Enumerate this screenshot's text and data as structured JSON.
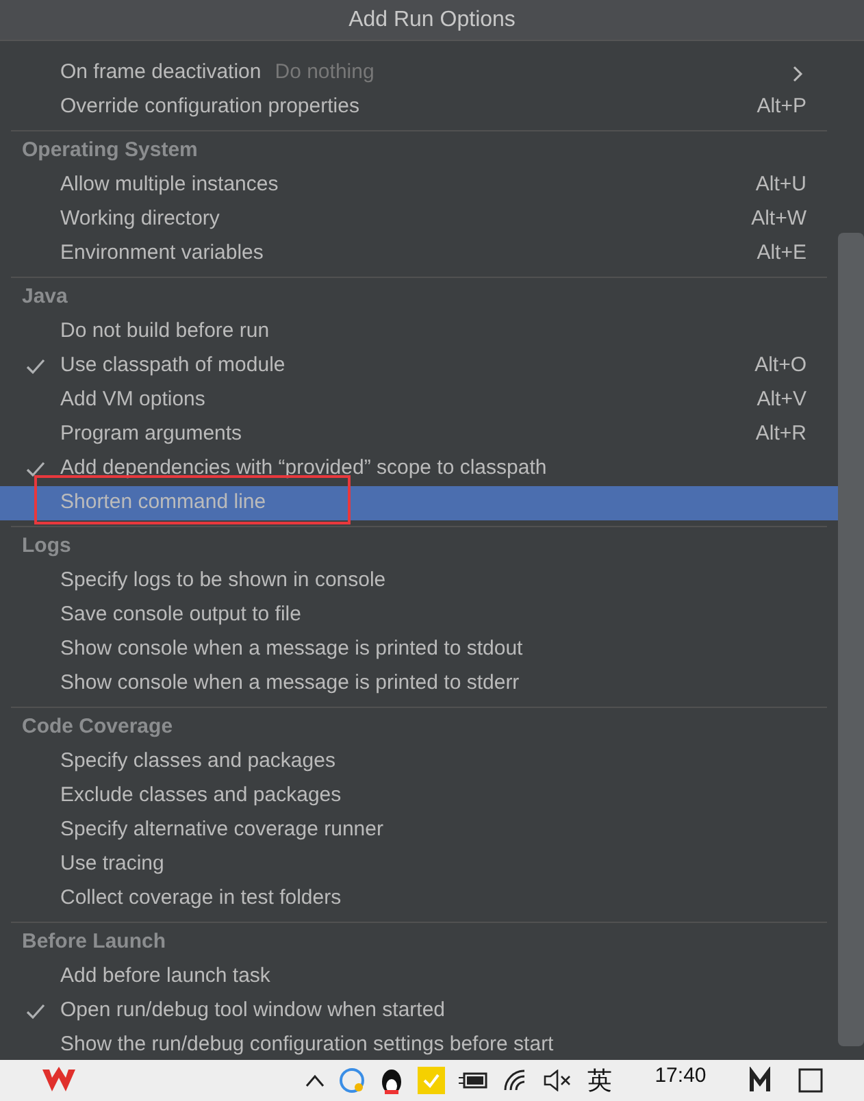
{
  "window": {
    "title": "Add Run Options"
  },
  "sections": [
    {
      "items": [
        {
          "label": "On frame deactivation",
          "value": "Do nothing",
          "submenu": true,
          "checked": false,
          "selected": false
        },
        {
          "label": "Override configuration properties",
          "shortcut": "Alt+P",
          "checked": false,
          "selected": false
        }
      ]
    },
    {
      "title": "Operating System",
      "items": [
        {
          "label": "Allow multiple instances",
          "shortcut": "Alt+U",
          "checked": false,
          "selected": false
        },
        {
          "label": "Working directory",
          "shortcut": "Alt+W",
          "checked": false,
          "selected": false
        },
        {
          "label": "Environment variables",
          "shortcut": "Alt+E",
          "checked": false,
          "selected": false
        }
      ]
    },
    {
      "title": "Java",
      "items": [
        {
          "label": "Do not build before run",
          "checked": false,
          "selected": false
        },
        {
          "label": "Use classpath of module",
          "shortcut": "Alt+O",
          "checked": true,
          "selected": false
        },
        {
          "label": "Add VM options",
          "shortcut": "Alt+V",
          "checked": false,
          "selected": false
        },
        {
          "label": "Program arguments",
          "shortcut": "Alt+R",
          "checked": false,
          "selected": false
        },
        {
          "label": "Add dependencies with “provided” scope to classpath",
          "checked": true,
          "selected": false
        },
        {
          "label": "Shorten command line",
          "checked": false,
          "selected": true,
          "annotated": true
        }
      ]
    },
    {
      "title": "Logs",
      "items": [
        {
          "label": "Specify logs to be shown in console",
          "checked": false,
          "selected": false
        },
        {
          "label": "Save console output to file",
          "checked": false,
          "selected": false
        },
        {
          "label": "Show console when a message is printed to stdout",
          "checked": false,
          "selected": false
        },
        {
          "label": "Show console when a message is printed to stderr",
          "checked": false,
          "selected": false
        }
      ]
    },
    {
      "title": "Code Coverage",
      "items": [
        {
          "label": "Specify classes and packages",
          "checked": false,
          "selected": false
        },
        {
          "label": "Exclude classes and packages",
          "checked": false,
          "selected": false
        },
        {
          "label": "Specify alternative coverage runner",
          "checked": false,
          "selected": false
        },
        {
          "label": "Use tracing",
          "checked": false,
          "selected": false
        },
        {
          "label": "Collect coverage in test folders",
          "checked": false,
          "selected": false
        }
      ]
    },
    {
      "title": "Before Launch",
      "items": [
        {
          "label": "Add before launch task",
          "checked": false,
          "selected": false
        },
        {
          "label": "Open run/debug tool window when started",
          "checked": true,
          "selected": false
        },
        {
          "label": "Show the run/debug configuration settings before start",
          "checked": false,
          "selected": false
        }
      ]
    }
  ],
  "taskbar": {
    "ime": "英",
    "time": "17:40"
  }
}
